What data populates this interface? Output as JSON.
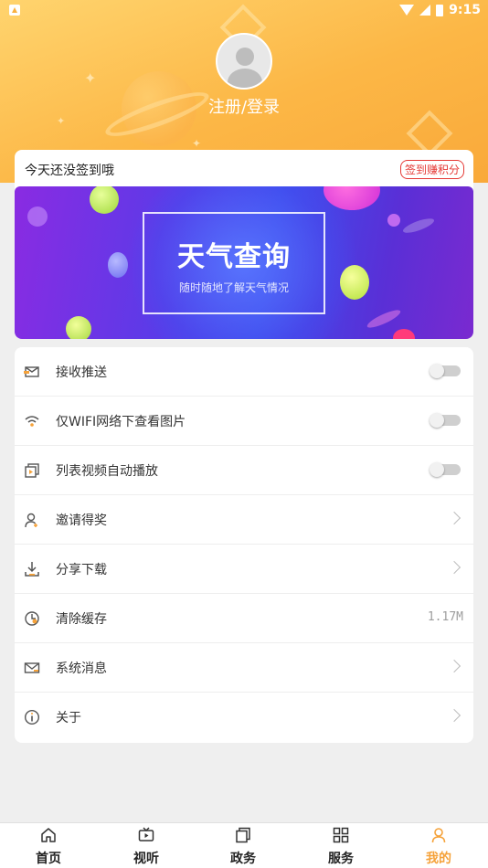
{
  "status_bar": {
    "time": "9:15"
  },
  "profile": {
    "login_label": "注册/登录"
  },
  "sign_in": {
    "prompt": "今天还没签到哦",
    "badge": "签到赚积分"
  },
  "banner": {
    "title": "天气查询",
    "subtitle": "随时随地了解天气情况"
  },
  "settings": [
    {
      "icon": "push-envelope-icon",
      "label": "接收推送",
      "control": "toggle",
      "on": false
    },
    {
      "icon": "wifi-icon",
      "label": "仅WIFI网络下查看图片",
      "control": "toggle",
      "on": false
    },
    {
      "icon": "video-autoplay-icon",
      "label": "列表视频自动播放",
      "control": "toggle",
      "on": false
    },
    {
      "icon": "invite-user-icon",
      "label": "邀请得奖",
      "control": "chevron"
    },
    {
      "icon": "download-icon",
      "label": "分享下载",
      "control": "chevron"
    },
    {
      "icon": "clear-cache-icon",
      "label": "清除缓存",
      "control": "value",
      "value": "1.17M"
    },
    {
      "icon": "mail-icon",
      "label": "系统消息",
      "control": "chevron"
    },
    {
      "icon": "info-icon",
      "label": "关于",
      "control": "chevron"
    }
  ],
  "bottom_nav": [
    {
      "icon": "home-icon",
      "label": "首页",
      "active": false
    },
    {
      "icon": "tv-icon",
      "label": "视听",
      "active": false
    },
    {
      "icon": "documents-icon",
      "label": "政务",
      "active": false
    },
    {
      "icon": "grid-icon",
      "label": "服务",
      "active": false
    },
    {
      "icon": "person-icon",
      "label": "我的",
      "active": true
    }
  ],
  "colors": {
    "accent": "#f5a23a",
    "header_from": "#ffd46e",
    "header_to": "#f9a93a",
    "badge_red": "#e53935"
  }
}
